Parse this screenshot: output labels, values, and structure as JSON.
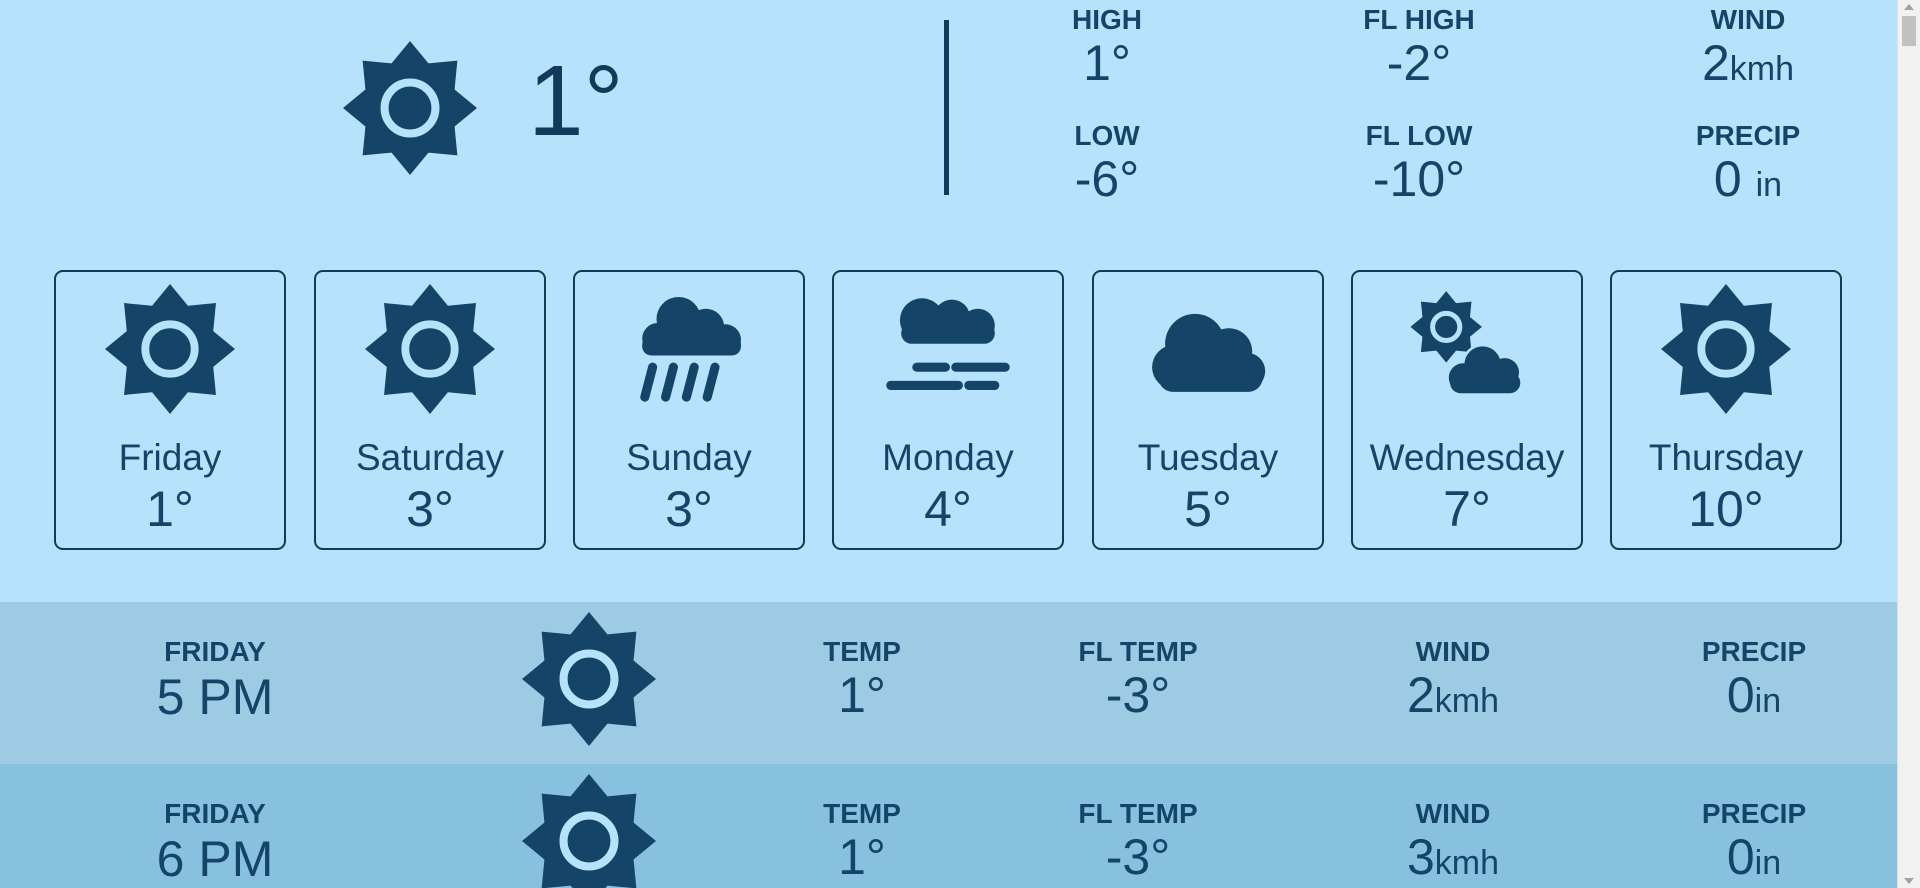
{
  "current": {
    "icon": "sun-icon",
    "temp": "1°",
    "high_label": "HIGH",
    "high_value": "1°",
    "low_label": "LOW",
    "low_value": "-6°",
    "fl_high_label": "FL HIGH",
    "fl_high_value": "-2°",
    "fl_low_label": "FL LOW",
    "fl_low_value": "-10°",
    "wind_label": "WIND",
    "wind_value": "2",
    "wind_unit": "kmh",
    "precip_label": "PRECIP",
    "precip_value": "0",
    "precip_unit": "in"
  },
  "days": [
    {
      "name": "Friday",
      "temp": "1°",
      "icon": "sun-icon"
    },
    {
      "name": "Saturday",
      "temp": "3°",
      "icon": "sun-icon"
    },
    {
      "name": "Sunday",
      "temp": "3°",
      "icon": "rain-icon"
    },
    {
      "name": "Monday",
      "temp": "4°",
      "icon": "fog-icon"
    },
    {
      "name": "Tuesday",
      "temp": "5°",
      "icon": "cloud-icon"
    },
    {
      "name": "Wednesday",
      "temp": "7°",
      "icon": "partly-cloudy-icon"
    },
    {
      "name": "Thursday",
      "temp": "10°",
      "icon": "sun-icon"
    }
  ],
  "hourly": [
    {
      "day": "FRIDAY",
      "time": "5 PM",
      "icon": "sun-icon",
      "temp_label": "TEMP",
      "temp": "1°",
      "fl_label": "FL TEMP",
      "fl": "-3°",
      "wind_label": "WIND",
      "wind": "2",
      "wind_unit": "kmh",
      "precip_label": "PRECIP",
      "precip": "0",
      "precip_unit": "in"
    },
    {
      "day": "FRIDAY",
      "time": "6 PM",
      "icon": "sun-icon",
      "temp_label": "TEMP",
      "temp": "1°",
      "fl_label": "FL TEMP",
      "fl": "-3°",
      "wind_label": "WIND",
      "wind": "3",
      "wind_unit": "kmh",
      "precip_label": "PRECIP",
      "precip": "0",
      "precip_unit": "in"
    }
  ],
  "colors": {
    "background": "#b6e3fb",
    "icon": "#154469",
    "row_odd": "#9dcbe4",
    "row_even": "#88c0e0"
  }
}
